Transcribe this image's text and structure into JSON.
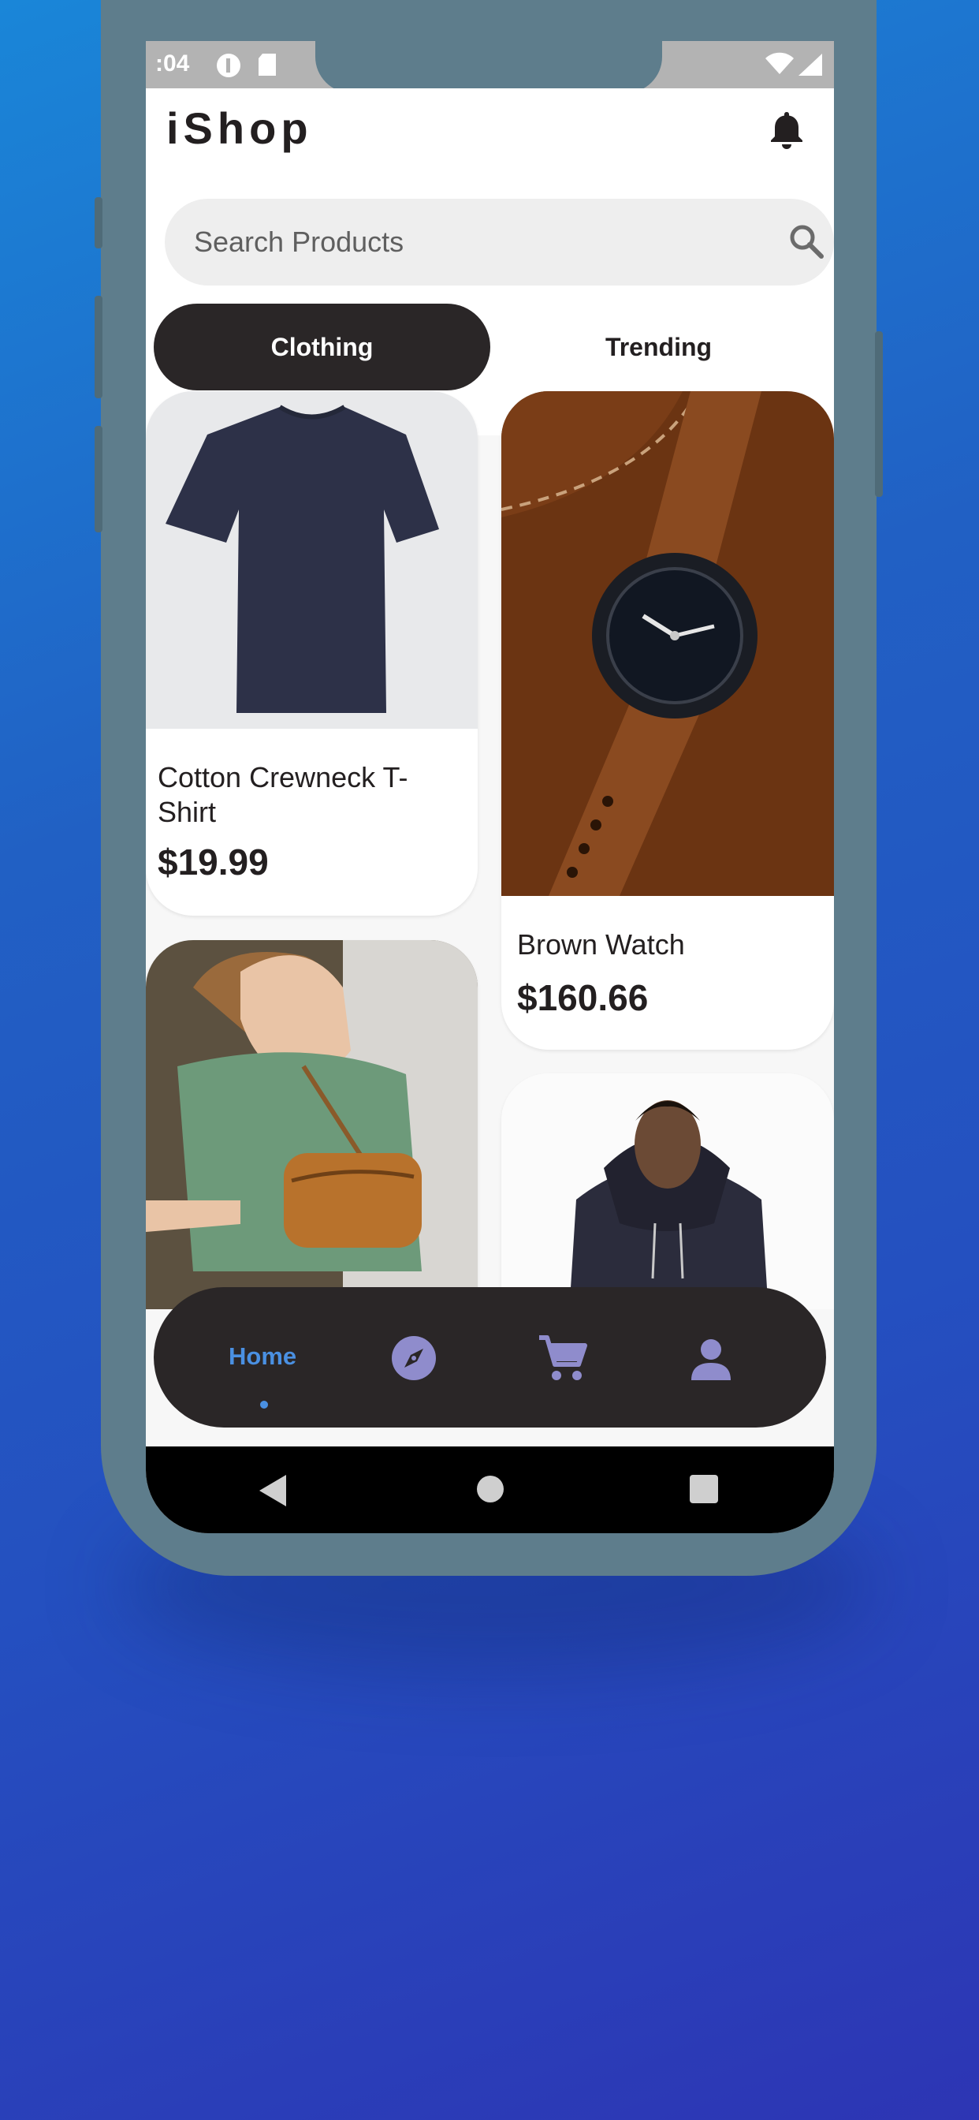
{
  "status_bar": {
    "time": ":04"
  },
  "app": {
    "title": "iShop"
  },
  "search": {
    "placeholder": "Search Products"
  },
  "tabs": [
    {
      "label": "Clothing",
      "active": true
    },
    {
      "label": "Trending",
      "active": false
    }
  ],
  "products": [
    {
      "name": "Cotton Crewneck T-Shirt",
      "price": "$19.99",
      "image": "navy-tshirt"
    },
    {
      "name": "Brown Watch",
      "price": "$160.66",
      "image": "brown-leather-watch"
    },
    {
      "name": "",
      "price": "",
      "image": "woman-with-crossbody-bag"
    },
    {
      "name": "",
      "price": "",
      "image": "man-in-black-hoodie"
    }
  ],
  "bottom_nav": {
    "home_label": "Home",
    "items": [
      "home",
      "explore-icon",
      "cart-icon",
      "profile-icon"
    ],
    "active_color": "#4a90e2",
    "icon_color": "#8f8ccc"
  },
  "colors": {
    "dark": "#2a2627",
    "phone_frame": "#5e7d8c",
    "background_gradient": [
      "#1a86d8",
      "#2d35b4"
    ]
  }
}
